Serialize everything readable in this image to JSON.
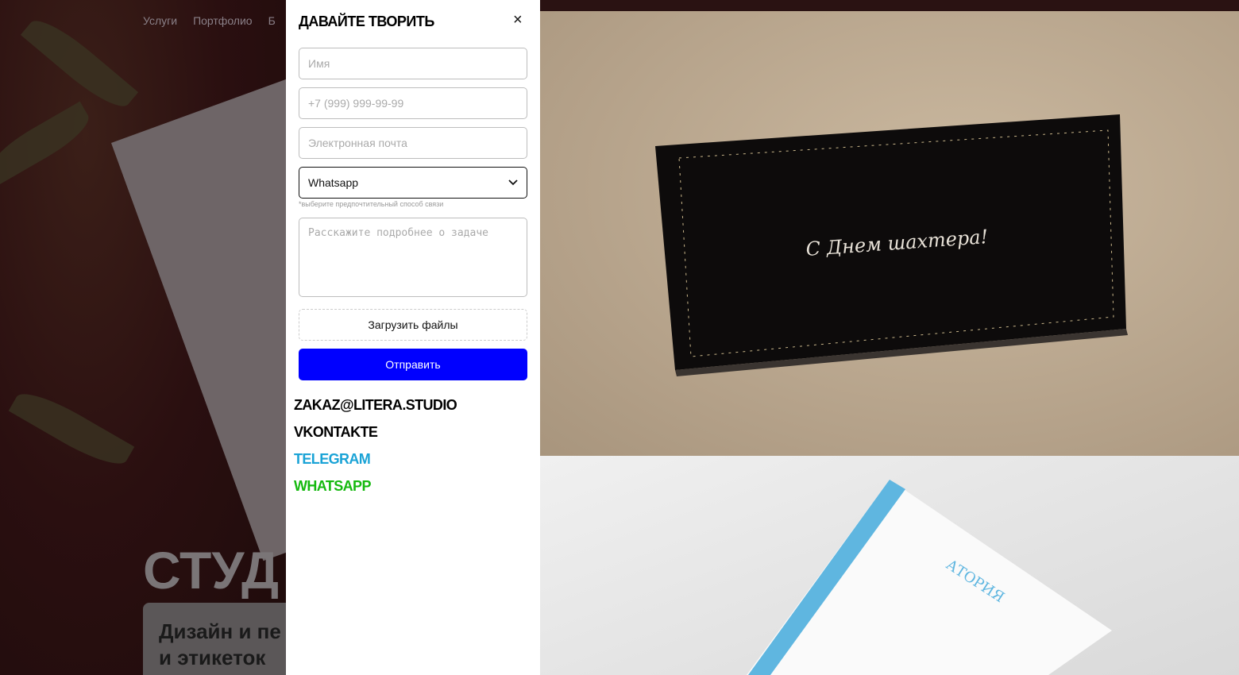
{
  "nav": {
    "items": [
      "Услуги",
      "Портфолио",
      "Б"
    ]
  },
  "hero": {
    "title": "СТУД",
    "subtitle_line1": "Дизайн и пе",
    "subtitle_line2": "и этикеток"
  },
  "modal": {
    "title": "ДАВАЙТЕ ТВОРИТЬ",
    "close": "×",
    "name_placeholder": "Имя",
    "phone_placeholder": "+7 (999) 999-99-99",
    "email_placeholder": "Электронная почта",
    "contact_method": "Whatsapp",
    "contact_hint": "*выберите предпочтительный способ связи",
    "message_placeholder": "Расскажите подробнее о задаче",
    "upload_label": "Загрузить файлы",
    "submit_label": "Отправить"
  },
  "links": [
    {
      "label": "ZAKAZ@LITERA.STUDIO",
      "color": "#000000"
    },
    {
      "label": "VKONTAKTE",
      "color": "#000000"
    },
    {
      "label": "TELEGRAM",
      "color": "#1aa3d6"
    },
    {
      "label": "WHATSAPP",
      "color": "#15b90f"
    }
  ],
  "gallery": {
    "card_text": "С Днем шахтера!",
    "letterhead_brand": "АТОРИЯ"
  },
  "colors": {
    "accent": "#0000ff"
  }
}
